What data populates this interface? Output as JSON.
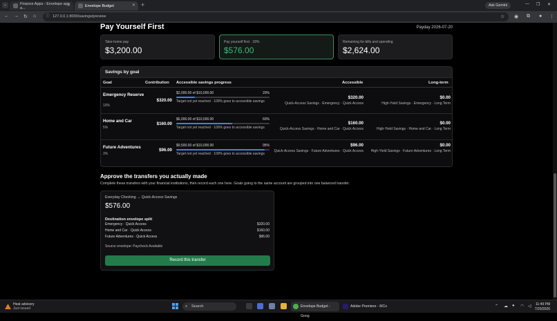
{
  "browser": {
    "tabs": [
      {
        "title": "Finance Apps - Envelope app a..."
      },
      {
        "title": "Envelope Budget"
      }
    ],
    "url": "127.0.0.1:8000/savings/preview",
    "ask_gemini": "Ask Gemini"
  },
  "page": {
    "title": "Pay Yourself First",
    "payday": "Payday 2026-07-20",
    "summary": [
      {
        "label": "Take-home pay",
        "value": "$3,200.00"
      },
      {
        "label": "Pay yourself first · 18%",
        "value": "$576.00"
      },
      {
        "label": "Remaining for bills and spending",
        "value": "$2,624.00"
      }
    ],
    "savings_by_goal": {
      "heading": "Savings by goal",
      "columns": [
        "Goal",
        "Contribution",
        "Accessible savings progress",
        "Accessible",
        "Long-term"
      ],
      "rows": [
        {
          "name": "Emergency Reserve",
          "pct": "10%",
          "contribution": "$320.00",
          "progress_text": "$2,000.00 of $10,000.00",
          "progress_pct": "20%",
          "progress_value": 0.2,
          "note": "Target not yet reached · 100% goes to accessible savings",
          "accessible": "$320.00",
          "accessible_dest": "Quick-Access Savings · Emergency · Quick Access",
          "longterm": "$0.00",
          "longterm_dest": "High-Yield Savings · Emergency · Long Term"
        },
        {
          "name": "Home and Car",
          "pct": "5%",
          "contribution": "$160.00",
          "progress_text": "$6,000.00 of $10,000.00",
          "progress_pct": "60%",
          "progress_value": 0.6,
          "note": "Target not yet reached · 100% goes to accessible savings",
          "accessible": "$160.00",
          "accessible_dest": "Quick-Access Savings · Home and Car · Quick Access",
          "longterm": "$0.00",
          "longterm_dest": "High-Yield Savings · Home and Car · Long Term"
        },
        {
          "name": "Future Adventures",
          "pct": "3%",
          "contribution": "$96.00",
          "progress_text": "$9,500.00 of $10,000.00",
          "progress_pct": "95%",
          "progress_value": 0.95,
          "note": "Target not yet reached · 100% goes to accessible savings",
          "accessible": "$96.00",
          "accessible_dest": "Quick-Access Savings · Future Adventures · Quick Access",
          "longterm": "$0.00",
          "longterm_dest": "High-Yield Savings · Future Adventures · Long Term"
        }
      ]
    },
    "transfers": {
      "title": "Approve the transfers you actually made",
      "subtitle": "Complete these transfers with your financial institutions, then record each one here. Goals going to the same account are grouped into one balanced transfer.",
      "card": {
        "route": "Everyday Checking → Quick-Access Savings",
        "amount": "$576.00",
        "split_heading": "Destination envelope split",
        "split": [
          {
            "name": "Emergency · Quick Access",
            "value": "$320.00"
          },
          {
            "name": "Home and Car · Quick Access",
            "value": "$160.00"
          },
          {
            "name": "Future Adventures · Quick Access",
            "value": "$96.00"
          }
        ],
        "source": "Source envelope: Paycheck Available",
        "button": "Record this transfer"
      }
    }
  },
  "taskbar": {
    "weather_title": "Heat advisory",
    "weather_sub": "Just issued",
    "search": "Search",
    "apps": [
      {
        "label": "Envelope Budget - Goog"
      },
      {
        "label": "Adobe Premiere - 8/Co"
      }
    ],
    "time": "11:49 PM",
    "date": "7/20/2026"
  }
}
